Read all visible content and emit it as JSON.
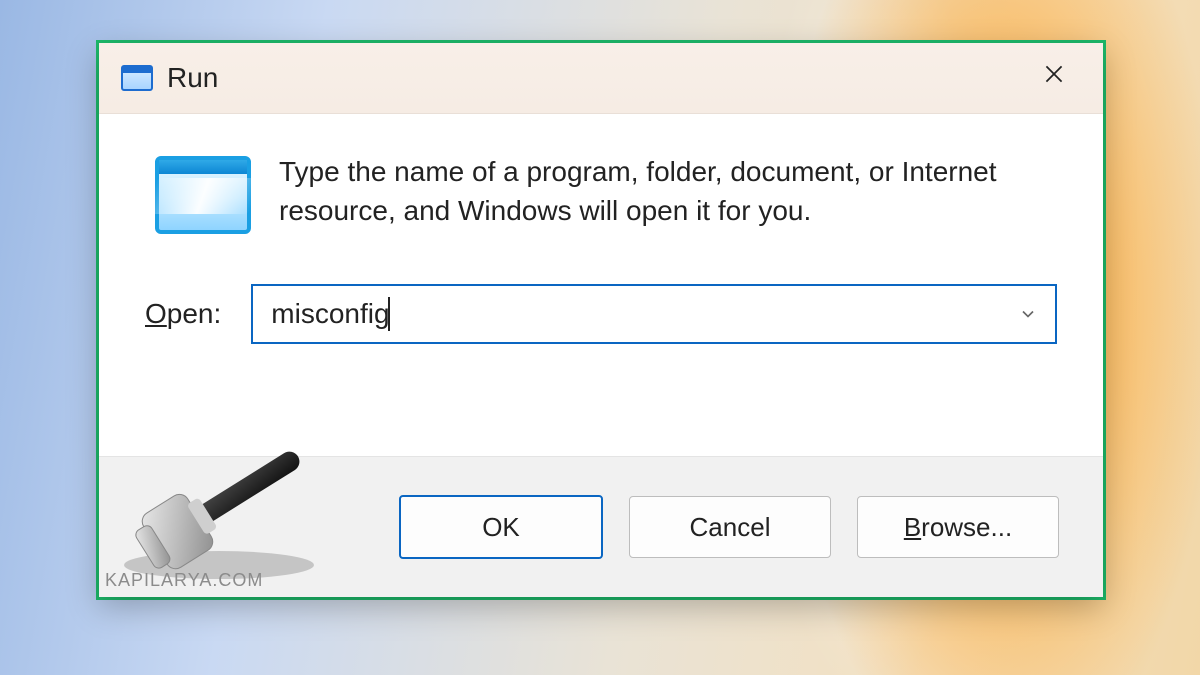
{
  "dialog": {
    "title": "Run",
    "instruction": "Type the name of a program, folder, document, or Internet resource, and Windows will open it for you.",
    "open_label_underlined_char": "O",
    "open_label_rest": "pen:",
    "input_value": "misconfig",
    "buttons": {
      "ok": "OK",
      "cancel": "Cancel",
      "browse_underlined_char": "B",
      "browse_rest": "rowse..."
    }
  },
  "watermark": {
    "text": "KAPILARYA.COM"
  },
  "colors": {
    "accent": "#0a66c2",
    "annotation_border": "#1db96a"
  }
}
